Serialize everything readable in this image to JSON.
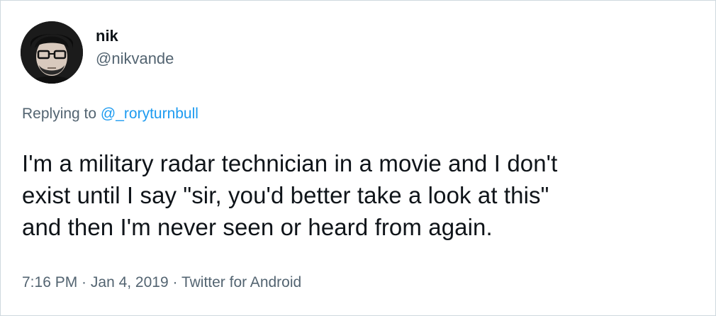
{
  "author": {
    "display_name": "nik",
    "handle": "@nikvande",
    "avatar_icon": "user-avatar-icon"
  },
  "reply": {
    "prefix": "Replying to ",
    "mention": "@_roryturnbull"
  },
  "tweet": {
    "lines": [
      "I'm a military radar technician in a movie and I don't",
      "exist until I say \"sir, you'd better take a look at this\"",
      "and then I'm never seen or heard from again."
    ]
  },
  "meta": {
    "time": "7:16 PM",
    "separator_1": " · ",
    "date": "Jan 4, 2019",
    "separator_2": " · ",
    "source": "Twitter for Android"
  },
  "colors": {
    "text_primary": "#0f1419",
    "text_secondary": "#536471",
    "link": "#1d9bf0",
    "border": "#cfd9de"
  }
}
